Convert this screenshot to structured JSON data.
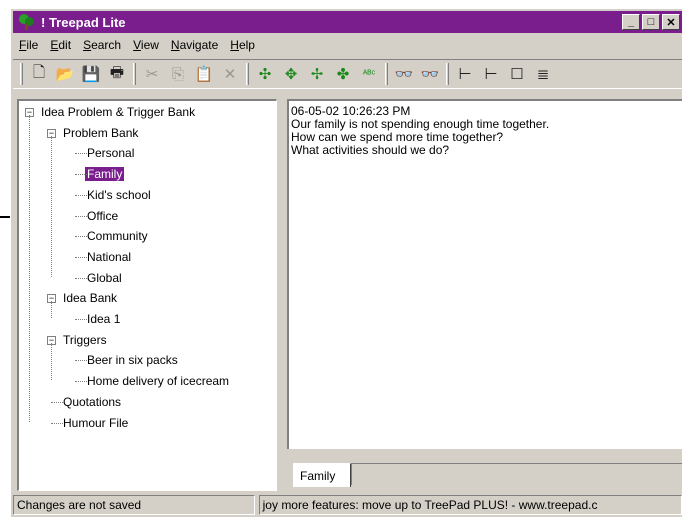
{
  "window": {
    "title": "! Treepad Lite"
  },
  "menubar": [
    {
      "label": "File",
      "key": "F"
    },
    {
      "label": "Edit",
      "key": "E"
    },
    {
      "label": "Search",
      "key": "S"
    },
    {
      "label": "View",
      "key": "V"
    },
    {
      "label": "Navigate",
      "key": "N"
    },
    {
      "label": "Help",
      "key": "H"
    }
  ],
  "toolbar": {
    "buttons": [
      {
        "name": "new-icon",
        "glyph": "🗋",
        "state": "enabled"
      },
      {
        "name": "open-icon",
        "glyph": "📂",
        "state": "enabled"
      },
      {
        "name": "save-icon",
        "glyph": "💾",
        "state": "enabled"
      },
      {
        "name": "print-icon",
        "glyph": "🖶",
        "state": "enabled"
      },
      {
        "name": "cut-icon",
        "glyph": "✂",
        "state": "disabled"
      },
      {
        "name": "copy-icon",
        "glyph": "⎘",
        "state": "disabled"
      },
      {
        "name": "paste-icon",
        "glyph": "📋",
        "state": "disabled"
      },
      {
        "name": "delete-icon",
        "glyph": "✕",
        "state": "disabled"
      },
      {
        "name": "move-up-icon",
        "glyph": "✣",
        "state": "green"
      },
      {
        "name": "move-down-icon",
        "glyph": "✥",
        "state": "green"
      },
      {
        "name": "move-left-icon",
        "glyph": "✢",
        "state": "green"
      },
      {
        "name": "move-right-icon",
        "glyph": "✤",
        "state": "green"
      },
      {
        "name": "spellcheck-icon",
        "glyph": "ᴬᴮᶜ",
        "state": "green"
      },
      {
        "name": "find-icon",
        "glyph": "👓",
        "state": "dark"
      },
      {
        "name": "find-next-icon",
        "glyph": "👓",
        "state": "blue"
      },
      {
        "name": "tree-view-icon",
        "glyph": "⊢",
        "state": "dark"
      },
      {
        "name": "tree-view-2-icon",
        "glyph": "⊢",
        "state": "dark"
      },
      {
        "name": "blank-page-icon",
        "glyph": "☐",
        "state": "dark"
      },
      {
        "name": "text-page-icon",
        "glyph": "≣",
        "state": "dark"
      }
    ]
  },
  "tree": [
    {
      "label": "Idea Problem & Trigger Bank",
      "level": 0,
      "expander": "−"
    },
    {
      "label": "Problem Bank",
      "level": 1,
      "expander": "−"
    },
    {
      "label": "Personal",
      "level": 2
    },
    {
      "label": "Family",
      "level": 2,
      "selected": true
    },
    {
      "label": "Kid's school",
      "level": 2
    },
    {
      "label": "Office",
      "level": 2
    },
    {
      "label": "Community",
      "level": 2
    },
    {
      "label": "National",
      "level": 2
    },
    {
      "label": "Global",
      "level": 2
    },
    {
      "label": "Idea Bank",
      "level": 1,
      "expander": "−"
    },
    {
      "label": "Idea 1",
      "level": 2
    },
    {
      "label": "Triggers",
      "level": 1,
      "expander": "−"
    },
    {
      "label": "Beer in six packs",
      "level": 2
    },
    {
      "label": "Home delivery of icecream",
      "level": 2
    },
    {
      "label": "Quotations",
      "level": 1
    },
    {
      "label": "Humour File",
      "level": 1
    }
  ],
  "editor": {
    "lines": [
      "06-05-02  10:26:23 PM",
      "Our family is not spending enough time together.",
      "How can we spend more time together?",
      "What activities should we do?"
    ]
  },
  "tab": {
    "label": "Family"
  },
  "statusbar": {
    "left": "Changes are not saved",
    "right": "joy more features: move up to TreePad PLUS! - www.treepad.c"
  },
  "colors": {
    "titlebar": "#7a1e8e",
    "selection": "#7a1e8e",
    "chrome": "#d4d0c8"
  }
}
